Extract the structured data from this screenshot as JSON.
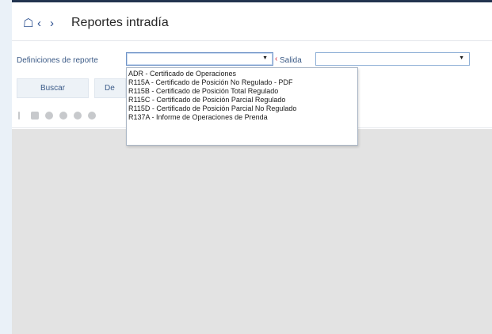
{
  "header": {
    "title": "Reportes intradía"
  },
  "form": {
    "definiciones_label": "Definiciones de reporte",
    "definiciones_value": "",
    "salida_label": "Salida",
    "salida_value": ""
  },
  "buttons": {
    "buscar": "Buscar",
    "second_partial": "De"
  },
  "dropdown": {
    "options": [
      "ADR - Certificado de Operaciones",
      "R115A - Certificado de Posición No Regulado - PDF",
      "R115B - Certificado de Posición Total Regulado",
      "R115C - Certificado de Posición Parcial Regulado",
      "R115D - Certificado de Posición Parcial No Regulado",
      "R137A - Informe de Operaciones de Prenda"
    ]
  },
  "toolbar": {
    "icons": [
      "save-icon",
      "print-icon",
      "circle-icon",
      "circle-icon",
      "circle-icon"
    ]
  },
  "colors": {
    "accent": "#2b4f8f",
    "label": "#3b5a86",
    "required": "#d11f2d",
    "grid": "#e3e3e3"
  }
}
